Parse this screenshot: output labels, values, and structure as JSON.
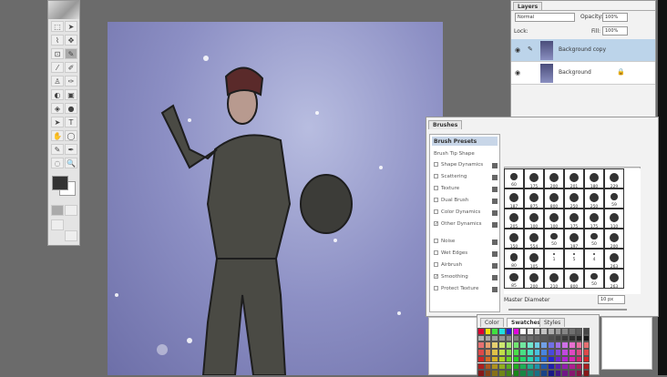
{
  "layers_panel": {
    "tab": "Layers",
    "blend_mode": "Normal",
    "opacity_label": "Opacity:",
    "opacity": "100%",
    "lock_label": "Lock:",
    "fill_label": "Fill:",
    "fill": "100%",
    "layers": [
      {
        "name": "Background copy",
        "selected": true
      },
      {
        "name": "Background",
        "selected": false,
        "locked": true
      }
    ]
  },
  "brushes_panel": {
    "tab": "Brushes",
    "presets": "Brush Presets",
    "tip_shape": "Brush Tip Shape",
    "options": [
      {
        "label": "Shape Dynamics",
        "checked": false
      },
      {
        "label": "Scattering",
        "checked": false
      },
      {
        "label": "Texture",
        "checked": false
      },
      {
        "label": "Dual Brush",
        "checked": false
      },
      {
        "label": "Color Dynamics",
        "checked": false
      },
      {
        "label": "Other Dynamics",
        "checked": true
      },
      {
        "label": "Noise",
        "checked": false
      },
      {
        "label": "Wet Edges",
        "checked": false
      },
      {
        "label": "Airbrush",
        "checked": false
      },
      {
        "label": "Smoothing",
        "checked": true
      },
      {
        "label": "Protect Texture",
        "checked": false
      }
    ],
    "brush_sizes": [
      "60",
      "175",
      "200",
      "201",
      "180",
      "229",
      "187",
      "875",
      "800",
      "250",
      "250",
      "59",
      "205",
      "100",
      "100",
      "175",
      "175",
      "110",
      "150",
      "554",
      "50",
      "197",
      "50",
      "200",
      "80",
      "105",
      "1",
      "5",
      "4",
      "263",
      "85",
      "200",
      "210",
      "800",
      "50",
      "263"
    ],
    "master_diameter_label": "Master Diameter",
    "master_diameter": "10 px"
  },
  "swatches_panel": {
    "tabs": [
      "Color",
      "Swatches",
      "Styles"
    ],
    "active": "Swatches"
  }
}
